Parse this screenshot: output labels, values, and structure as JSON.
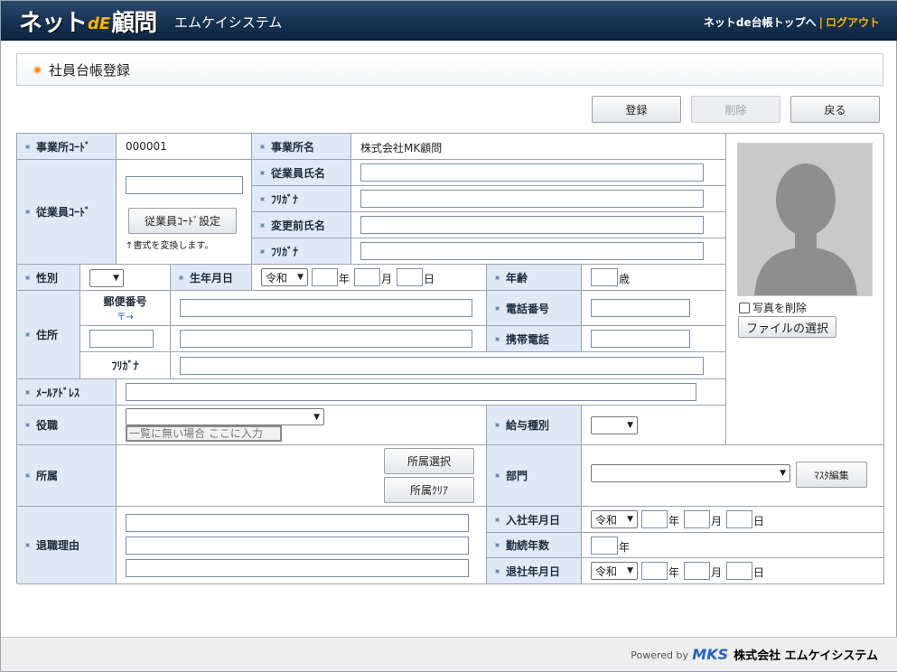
{
  "header": {
    "logo_net": "ネット",
    "logo_de": "dE",
    "logo_komon": "顧問",
    "company": "エムケイシステム",
    "top_link": "ネットde台帳トップへ",
    "separator": "|",
    "logout": "ログアウト"
  },
  "page": {
    "title": "社員台帳登録"
  },
  "actions": {
    "register": "登録",
    "delete": "削除",
    "back": "戻る"
  },
  "labels": {
    "office_code": "事業所ｺｰﾄﾞ",
    "office_name": "事業所名",
    "employee_code": "従業員ｺｰﾄﾞ",
    "employee_name": "従業員氏名",
    "furigana": "ﾌﾘｶﾞﾅ",
    "former_name": "変更前氏名",
    "gender": "性別",
    "birthdate": "生年月日",
    "age": "年齢",
    "address": "住所",
    "postal": "郵便番号",
    "postal_arrow": "〒→",
    "phone": "電話番号",
    "mobile": "携帯電話",
    "addr_furigana": "ﾌﾘｶﾞﾅ",
    "email": "ﾒｰﾙｱﾄﾞﾚｽ",
    "position": "役職",
    "salary_type": "給与種別",
    "affiliation": "所属",
    "department": "部門",
    "retire_reason": "退職理由",
    "join_date": "入社年月日",
    "service_years": "勤続年数",
    "retire_date": "退社年月日"
  },
  "values": {
    "office_code": "000001",
    "office_name": "株式会社MK顧問",
    "era": "令和",
    "unit_year": "年",
    "unit_month": "月",
    "unit_day": "日",
    "unit_age": "歳",
    "unit_years": "年",
    "position_placeholder": "一覧に無い場合 ここに入力",
    "code_hint": "↑書式を変換します。"
  },
  "buttons": {
    "code_setting": "従業員ｺｰﾄﾞ設定",
    "affiliation_select": "所属選択",
    "affiliation_clear": "所属ｸﾘｱ",
    "master_edit": "ﾏｽﾀ編集",
    "file_select": "ファイルの選択"
  },
  "photo": {
    "delete_label": "写真を削除"
  },
  "footer": {
    "powered": "Powered by",
    "mark": "MKS",
    "company": "株式会社 エムケイシステム"
  }
}
